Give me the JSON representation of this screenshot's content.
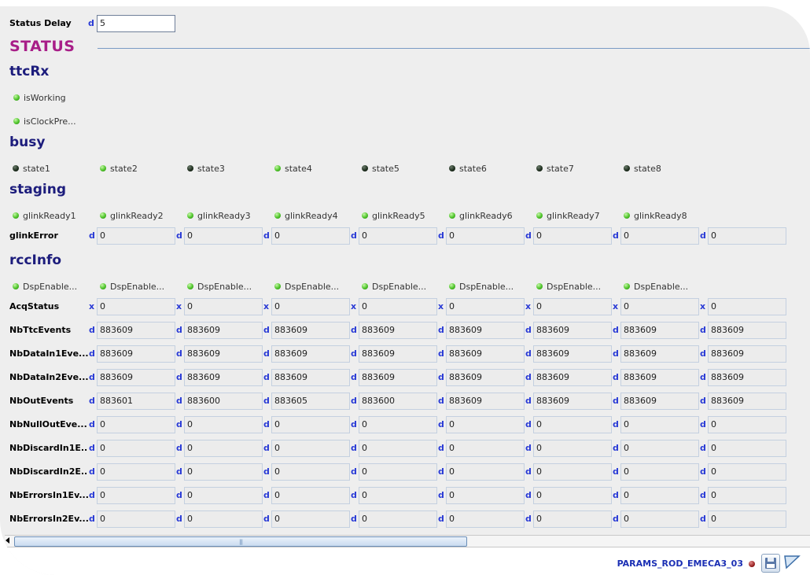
{
  "status_delay": {
    "label": "Status Delay",
    "fmt": "d",
    "value": "5"
  },
  "status_heading": "STATUS",
  "ttcrx": {
    "heading": "ttcRx",
    "leds": [
      {
        "label": "isWorking",
        "state": "on"
      },
      {
        "label": "isClockPre...",
        "state": "on"
      }
    ]
  },
  "busy": {
    "heading": "busy",
    "leds": [
      {
        "label": "state1",
        "state": "off"
      },
      {
        "label": "state2",
        "state": "on"
      },
      {
        "label": "state3",
        "state": "off"
      },
      {
        "label": "state4",
        "state": "on"
      },
      {
        "label": "state5",
        "state": "off"
      },
      {
        "label": "state6",
        "state": "off"
      },
      {
        "label": "state7",
        "state": "off"
      },
      {
        "label": "state8",
        "state": "off"
      }
    ]
  },
  "staging": {
    "heading": "staging",
    "leds": [
      {
        "label": "glinkReady1",
        "state": "on"
      },
      {
        "label": "glinkReady2",
        "state": "on"
      },
      {
        "label": "glinkReady3",
        "state": "on"
      },
      {
        "label": "glinkReady4",
        "state": "on"
      },
      {
        "label": "glinkReady5",
        "state": "on"
      },
      {
        "label": "glinkReady6",
        "state": "on"
      },
      {
        "label": "glinkReady7",
        "state": "on"
      },
      {
        "label": "glinkReady8",
        "state": "on"
      }
    ],
    "glink_error": {
      "label": "glinkError",
      "fmt": "d",
      "values": [
        "0",
        "0",
        "0",
        "0",
        "0",
        "0",
        "0",
        "0"
      ]
    }
  },
  "rccinfo": {
    "heading": "rccInfo",
    "leds": [
      {
        "label": "DspEnable...",
        "state": "on"
      },
      {
        "label": "DspEnable...",
        "state": "on"
      },
      {
        "label": "DspEnable...",
        "state": "on"
      },
      {
        "label": "DspEnable...",
        "state": "on"
      },
      {
        "label": "DspEnable...",
        "state": "on"
      },
      {
        "label": "DspEnable...",
        "state": "on"
      },
      {
        "label": "DspEnable...",
        "state": "on"
      },
      {
        "label": "DspEnable...",
        "state": "on"
      }
    ],
    "rows": [
      {
        "label": "AcqStatus",
        "fmt": "x",
        "values": [
          "0",
          "0",
          "0",
          "0",
          "0",
          "0",
          "0",
          "0"
        ]
      },
      {
        "label": "NbTtcEvents",
        "fmt": "d",
        "values": [
          "883609",
          "883609",
          "883609",
          "883609",
          "883609",
          "883609",
          "883609",
          "883609"
        ]
      },
      {
        "label": "NbDataIn1Eve...",
        "fmt": "d",
        "values": [
          "883609",
          "883609",
          "883609",
          "883609",
          "883609",
          "883609",
          "883609",
          "883609"
        ]
      },
      {
        "label": "NbDataIn2Eve...",
        "fmt": "d",
        "values": [
          "883609",
          "883609",
          "883609",
          "883609",
          "883609",
          "883609",
          "883609",
          "883609"
        ]
      },
      {
        "label": "NbOutEvents",
        "fmt": "d",
        "values": [
          "883601",
          "883600",
          "883605",
          "883600",
          "883609",
          "883609",
          "883609",
          "883609"
        ]
      },
      {
        "label": "NbNullOutEve...",
        "fmt": "d",
        "values": [
          "0",
          "0",
          "0",
          "0",
          "0",
          "0",
          "0",
          "0"
        ]
      },
      {
        "label": "NbDiscardIn1E...",
        "fmt": "d",
        "values": [
          "0",
          "0",
          "0",
          "0",
          "0",
          "0",
          "0",
          "0"
        ]
      },
      {
        "label": "NbDiscardIn2E...",
        "fmt": "d",
        "values": [
          "0",
          "0",
          "0",
          "0",
          "0",
          "0",
          "0",
          "0"
        ]
      },
      {
        "label": "NbErrorsIn1Ev...",
        "fmt": "d",
        "values": [
          "0",
          "0",
          "0",
          "0",
          "0",
          "0",
          "0",
          "0"
        ]
      },
      {
        "label": "NbErrorsIn2Ev...",
        "fmt": "d",
        "values": [
          "0",
          "0",
          "0",
          "0",
          "0",
          "0",
          "0",
          "0"
        ]
      }
    ]
  },
  "footer": {
    "name": "PARAMS_ROD_EMECA3_03",
    "state_color": "#8e1515"
  },
  "icons": {
    "save": "floppy-save-icon",
    "corner": "corner-arrow-icon",
    "scroll_left": "arrow-left-icon"
  }
}
